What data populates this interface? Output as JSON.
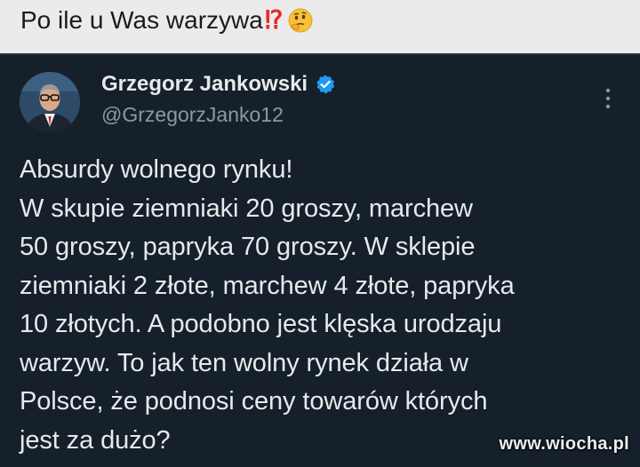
{
  "post": {
    "caption": "Po ile u Was warzywa",
    "caption_emojis": [
      "double-exclamation-question-icon",
      "thinking-face-icon"
    ]
  },
  "tweet": {
    "author_name": "Grzegorz Jankowski",
    "author_handle": "@GrzegorzJanko12",
    "verified": true,
    "text": "Absurdy wolnego rynku!\nW skupie ziemniaki 20 groszy, marchew\n50 groszy, papryka 70 groszy. W sklepie\nziemniaki 2 złote, marchew 4 złote, papryka\n10 złotych. A podobno jest klęska urodzaju\nwarzyw. To jak ten wolny rynek działa w\nPolsce, że podnosi ceny towarów których\njest za dużo?"
  },
  "watermark": "www.wiocha.pl",
  "colors": {
    "topbar_bg": "#ebebeb",
    "card_bg": "#15202b",
    "text_primary": "#e7e9ea",
    "text_secondary": "#8b98a5",
    "verified_blue": "#1d9bf0"
  }
}
